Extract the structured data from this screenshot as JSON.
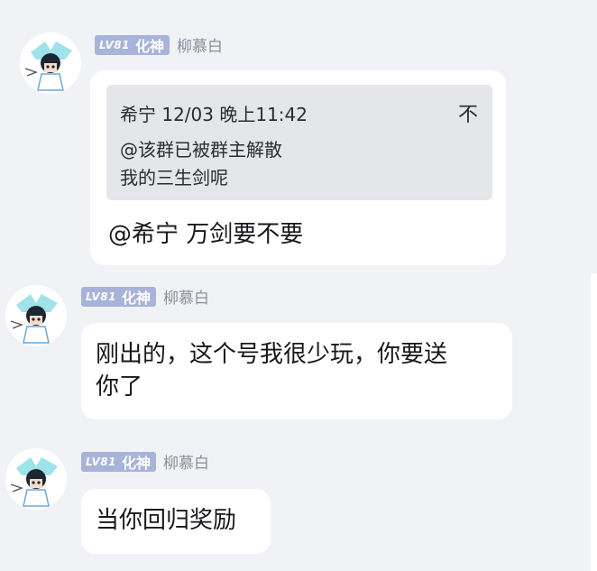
{
  "messages": [
    {
      "sender": {
        "level": "LV81",
        "rank": "化神",
        "nickname": "柳慕白"
      },
      "quote": {
        "author": "希宁",
        "time": "12/03 晚上11:42",
        "lines": [
          "@该群已被群主解散",
          "我的三生剑呢"
        ],
        "close_glyph": "不"
      },
      "text": "@希宁 万剑要不要"
    },
    {
      "sender": {
        "level": "LV81",
        "rank": "化神",
        "nickname": "柳慕白"
      },
      "text_lines": [
        "刚出的，这个号我很少玩，你要送",
        "你了"
      ]
    },
    {
      "sender": {
        "level": "LV81",
        "rank": "化神",
        "nickname": "柳慕白"
      },
      "text": "当你回归奖励"
    }
  ],
  "colors": {
    "background": "#f1f2f6",
    "bubble": "#ffffff",
    "quote_background": "#e5e6e9",
    "badge": "#a7b3d8",
    "nickname": "#8c8f97"
  },
  "icons": [
    "avatar-anime-character"
  ]
}
